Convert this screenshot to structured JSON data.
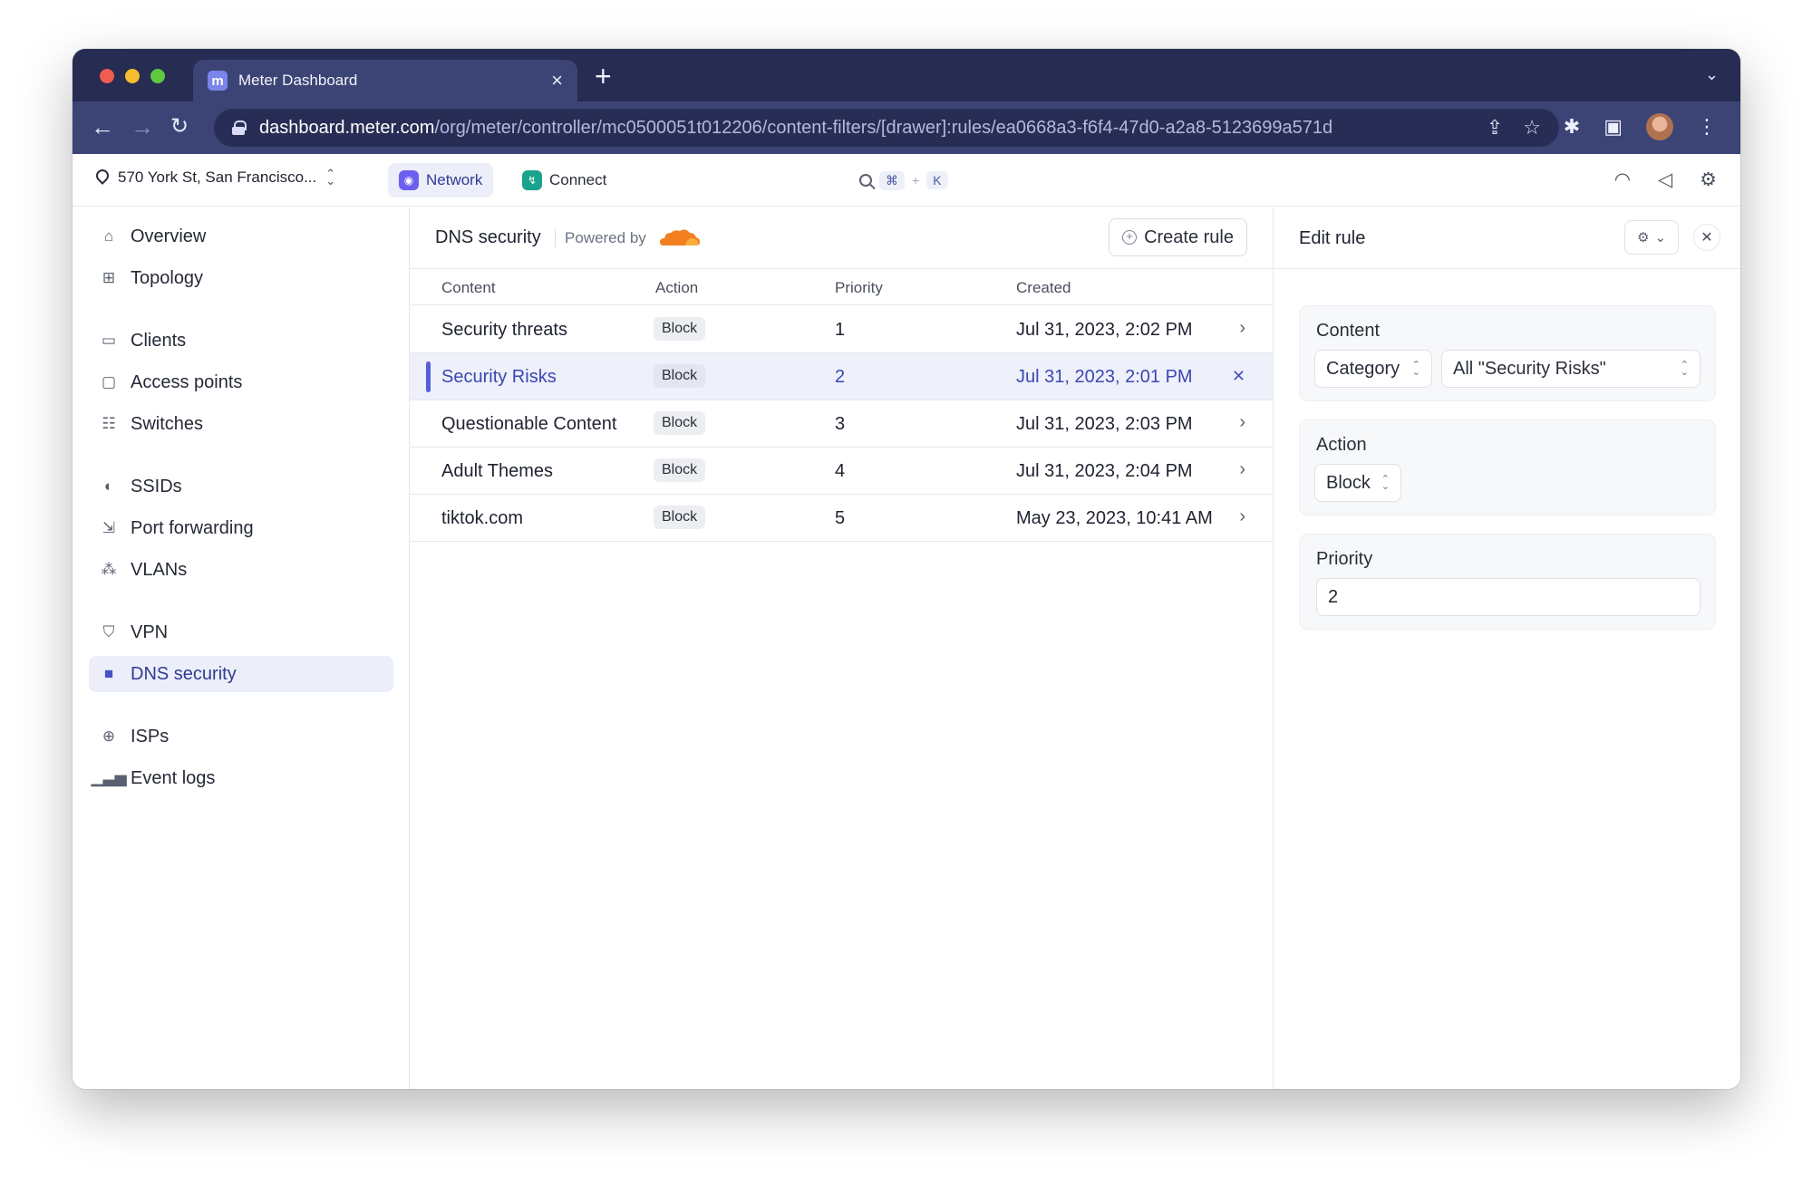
{
  "browser": {
    "tab_title": "Meter Dashboard",
    "tab_favicon": "m",
    "url_host": "dashboard.meter.com",
    "url_path": "/org/meter/controller/mc0500051t012206/content-filters/[drawer]:rules/ea0668a3-f6f4-47d0-a2a8-5123699a571d"
  },
  "topbar": {
    "location": "570 York St, San Francisco...",
    "network_label": "Network",
    "connect_label": "Connect",
    "shortcut_key1": "⌘",
    "shortcut_plus": "+",
    "shortcut_key2": "K"
  },
  "sidebar": {
    "items": [
      {
        "label": "Overview",
        "icon": "home-icon"
      },
      {
        "label": "Topology",
        "icon": "topology-icon"
      },
      {
        "label": "Clients",
        "icon": "devices-icon"
      },
      {
        "label": "Access points",
        "icon": "access-point-icon"
      },
      {
        "label": "Switches",
        "icon": "switch-icon"
      },
      {
        "label": "SSIDs",
        "icon": "toggle-icon"
      },
      {
        "label": "Port forwarding",
        "icon": "port-forward-icon"
      },
      {
        "label": "VLANs",
        "icon": "hierarchy-icon"
      },
      {
        "label": "VPN",
        "icon": "shield-icon"
      },
      {
        "label": "DNS security",
        "icon": "lock-icon",
        "active": true
      },
      {
        "label": "ISPs",
        "icon": "globe-icon"
      },
      {
        "label": "Event logs",
        "icon": "bar-chart-icon"
      }
    ]
  },
  "main": {
    "title": "DNS security",
    "powered_by": "Powered by",
    "create_rule": "Create rule",
    "columns": [
      "Content",
      "Action",
      "Priority",
      "Created"
    ],
    "rows": [
      {
        "content": "Security threats",
        "action": "Block",
        "priority": "1",
        "created": "Jul 31, 2023, 2:02 PM"
      },
      {
        "content": "Security Risks",
        "action": "Block",
        "priority": "2",
        "created": "Jul 31, 2023, 2:01 PM",
        "selected": true
      },
      {
        "content": "Questionable Content",
        "action": "Block",
        "priority": "3",
        "created": "Jul 31, 2023, 2:03 PM"
      },
      {
        "content": "Adult Themes",
        "action": "Block",
        "priority": "4",
        "created": "Jul 31, 2023, 2:04 PM"
      },
      {
        "content": "tiktok.com",
        "action": "Block",
        "priority": "5",
        "created": "May 23, 2023, 10:41 AM"
      }
    ]
  },
  "drawer": {
    "title": "Edit rule",
    "content_label": "Content",
    "content_type": "Category",
    "content_value": "All \"Security Risks\"",
    "action_label": "Action",
    "action_value": "Block",
    "priority_label": "Priority",
    "priority_value": "2"
  },
  "colors": {
    "chrome_dark": "#262c52",
    "chrome_light": "#3b4475",
    "accent": "#4553c3",
    "selected_row": "#eef0fa",
    "cloudflare": "#f38020"
  }
}
